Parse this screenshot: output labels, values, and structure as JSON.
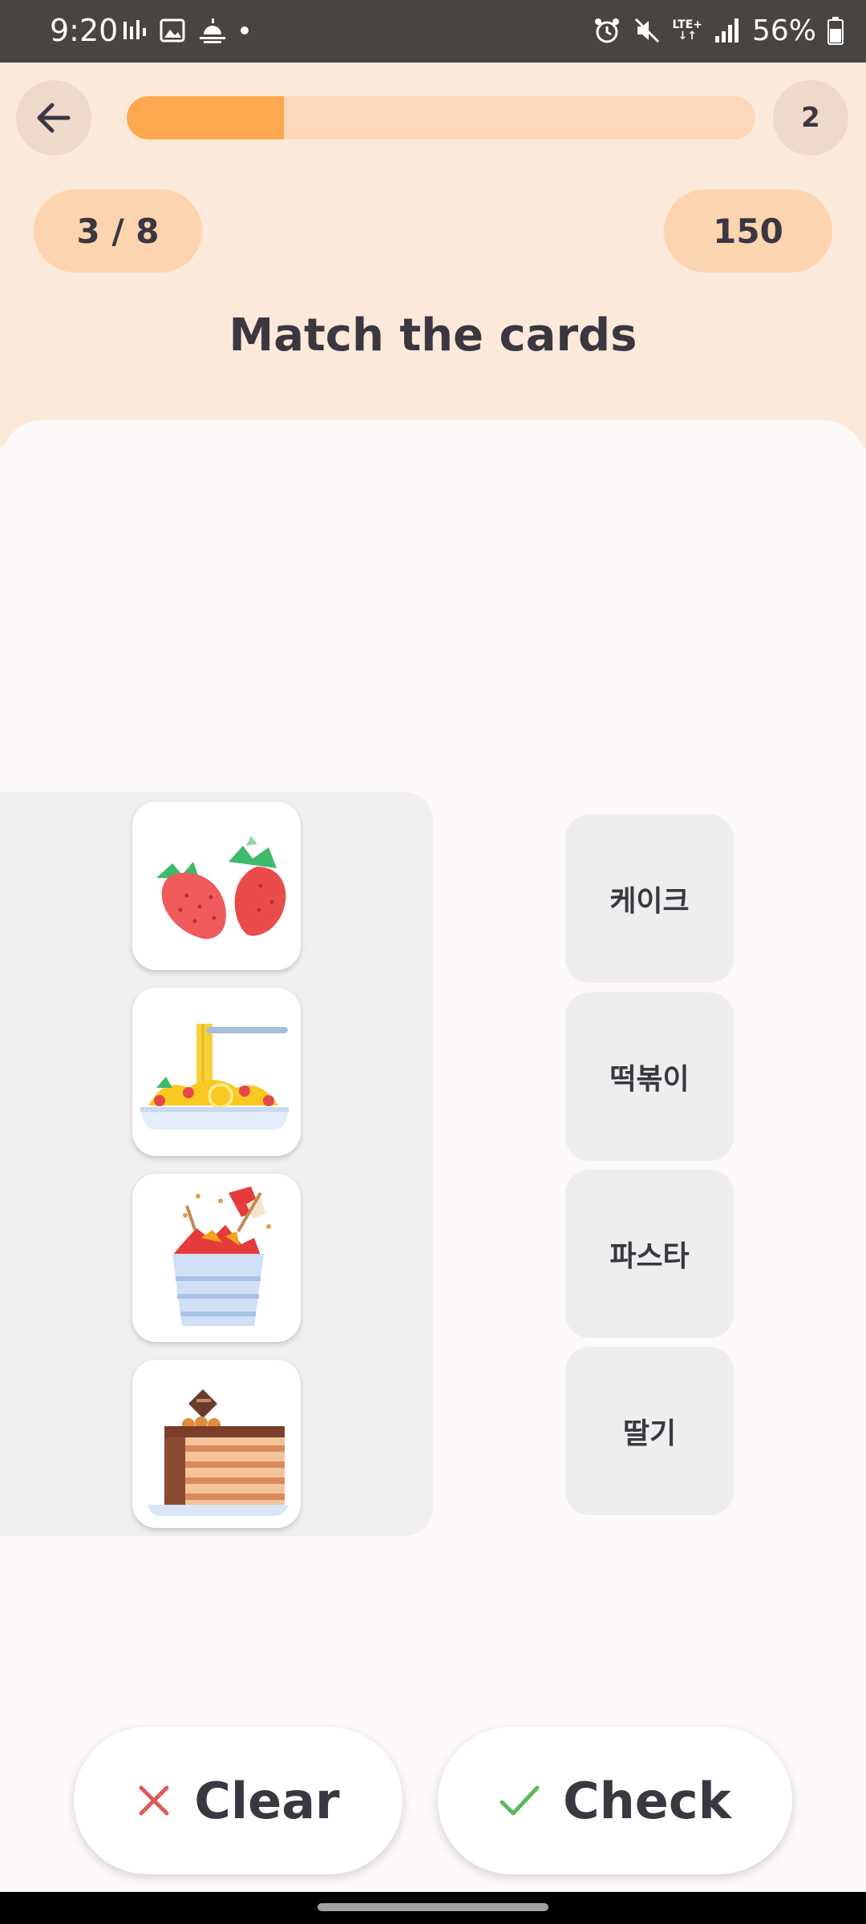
{
  "status_bar": {
    "time": "9:20",
    "lte_label": "LTE+",
    "battery": "56%",
    "icons": [
      "activity-icon",
      "gallery-icon",
      "weather-icon",
      "dot-icon",
      "alarm-icon",
      "mute-icon",
      "lte-icon",
      "signal-icon",
      "battery-icon"
    ]
  },
  "header": {
    "progress_fraction": 0.25,
    "progress_color": "#fea950",
    "lives": "2",
    "question_counter": "3 / 8",
    "score": "150"
  },
  "title": "Match the cards",
  "picture_cards": [
    {
      "icon": "strawberry-icon"
    },
    {
      "icon": "pasta-icon"
    },
    {
      "icon": "tteokbokki-icon"
    },
    {
      "icon": "cake-icon"
    }
  ],
  "word_cards": [
    {
      "label": "케이크"
    },
    {
      "label": "떡볶이"
    },
    {
      "label": "파스타"
    },
    {
      "label": "딸기"
    }
  ],
  "actions": {
    "clear_label": "Clear",
    "check_label": "Check"
  },
  "colors": {
    "accent": "#fea950",
    "header_bg": "#fde9da",
    "clear_icon": "#e05a5a",
    "check_icon": "#5cb85c"
  }
}
